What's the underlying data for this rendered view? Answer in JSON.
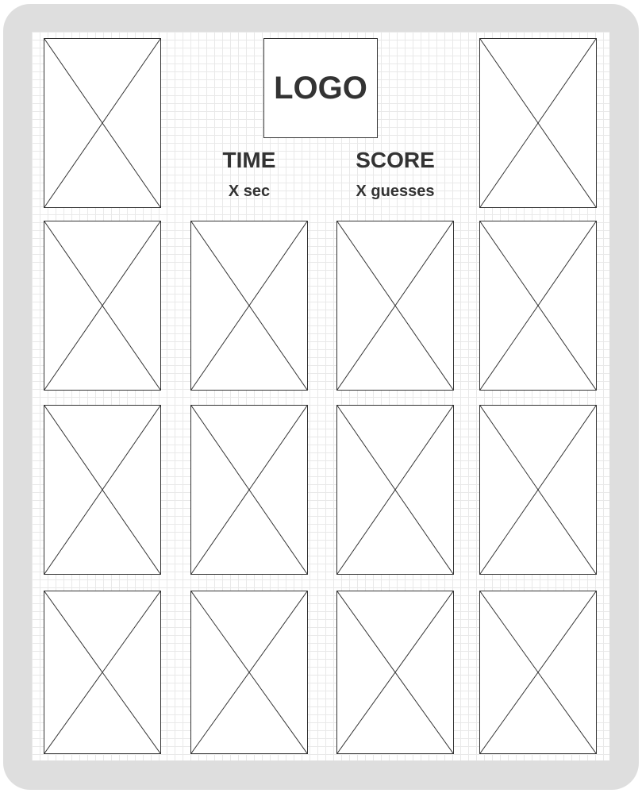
{
  "header": {
    "logo_text": "LOGO",
    "time": {
      "label": "TIME",
      "value": "X sec"
    },
    "score": {
      "label": "SCORE",
      "value": "X guesses"
    }
  },
  "board": {
    "card_placeholder_count": 14
  },
  "colors": {
    "frame": "#dedede",
    "canvas": "#ffffff",
    "grid": "#e9e9e9",
    "stroke": "#333333",
    "text": "#333333"
  }
}
